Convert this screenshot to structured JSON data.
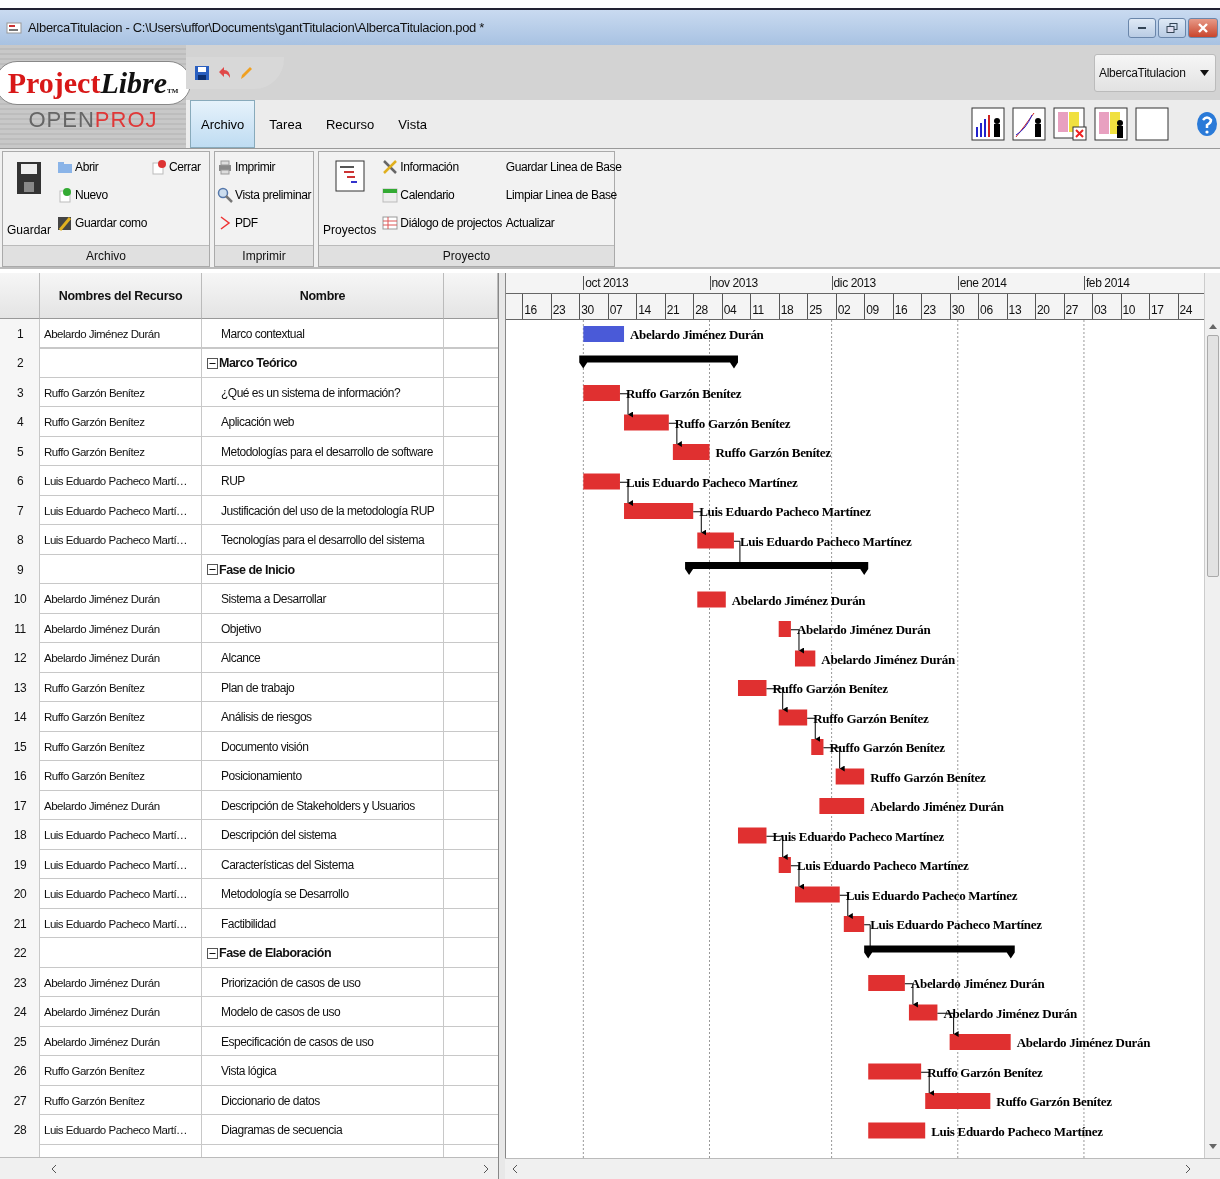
{
  "window": {
    "title": "AlbercaTitulacion - C:\\Users\\uffor\\Documents\\gantTitulacion\\AlbercaTitulacion.pod *"
  },
  "logo": {
    "first": "Project",
    "second": "Libre",
    "mark": "TM",
    "sub_first": "OPEN",
    "sub_second": "PROJ"
  },
  "project_selector": {
    "value": "AlbercaTitulacion"
  },
  "tabs": [
    {
      "label": "Archivo",
      "selected": true
    },
    {
      "label": "Tarea",
      "selected": false
    },
    {
      "label": "Recurso",
      "selected": false
    },
    {
      "label": "Vista",
      "selected": false
    }
  ],
  "ribbon": {
    "archivo": {
      "title": "Archivo",
      "save": "Guardar",
      "open": "Abrir",
      "new": "Nuevo",
      "save_as": "Guardar como",
      "close": "Cerrar"
    },
    "imprimir": {
      "title": "Imprimir",
      "print": "Imprimir",
      "preview": "Vista preliminar",
      "pdf": "PDF"
    },
    "proyecto": {
      "title": "Proyecto",
      "projects": "Proyectos",
      "info": "Información",
      "calendar": "Calendario",
      "dialog": "Diálogo de projectos",
      "save_baseline": "Guardar Linea de Base",
      "clear_baseline": "Limpiar Linea de Base",
      "update": "Actualizar"
    }
  },
  "table": {
    "columns": [
      "Nombres del Recurso",
      "Nombre"
    ]
  },
  "timescale": {
    "months": [
      "oct 2013",
      "nov 2013",
      "dic 2013",
      "ene 2014",
      "feb 2014"
    ],
    "weeks": [
      "16",
      "23",
      "30",
      "07",
      "14",
      "21",
      "28",
      "04",
      "11",
      "18",
      "25",
      "02",
      "09",
      "16",
      "23",
      "30",
      "06",
      "13",
      "20",
      "27",
      "03",
      "10",
      "17",
      "24"
    ]
  },
  "rows": [
    {
      "id": "1",
      "kind": "task",
      "resource": "Abelardo Jiménez Durán",
      "name": "Marco contextual",
      "color": "#4a5ad8",
      "bar_label": "Abelardo Jiménez Durán"
    },
    {
      "id": "2",
      "kind": "summary",
      "name": "Marco Teórico",
      "expanded": true
    },
    {
      "id": "3",
      "kind": "task",
      "resource": "Ruffo Garzón Benítez",
      "name": "¿Qué es un sistema de información?",
      "color": "#e03030",
      "bar_label": "Ruffo Garzón Benítez"
    },
    {
      "id": "4",
      "kind": "task",
      "resource": "Ruffo Garzón Benítez",
      "name": "Aplicación web",
      "color": "#e03030",
      "bar_label": "Ruffo Garzón Benítez"
    },
    {
      "id": "5",
      "kind": "task",
      "resource": "Ruffo Garzón Benítez",
      "name": "Metodologías para el desarrollo de software",
      "color": "#e03030",
      "bar_label": "Ruffo Garzón Benítez"
    },
    {
      "id": "6",
      "kind": "task",
      "resource": "Luis Eduardo Pacheco Martí…",
      "name": "RUP",
      "color": "#e03030",
      "bar_label": "Luis Eduardo Pacheco Martínez"
    },
    {
      "id": "7",
      "kind": "task",
      "resource": "Luis Eduardo Pacheco Martí…",
      "name": "Justificación  del uso de la metodología RUP",
      "color": "#e03030",
      "bar_label": "Luis Eduardo Pacheco Martínez"
    },
    {
      "id": "8",
      "kind": "task",
      "resource": "Luis Eduardo Pacheco Martí…",
      "name": "Tecnologías para el desarrollo del sistema",
      "color": "#e03030",
      "bar_label": "Luis Eduardo Pacheco Martínez"
    },
    {
      "id": "9",
      "kind": "summary",
      "name": "Fase de Inicio",
      "expanded": true
    },
    {
      "id": "10",
      "kind": "task",
      "resource": "Abelardo Jiménez Durán",
      "name": "Sistema a Desarrollar",
      "color": "#e03030",
      "bar_label": "Abelardo Jiménez Durán"
    },
    {
      "id": "11",
      "kind": "task",
      "resource": "Abelardo Jiménez Durán",
      "name": "Objetivo",
      "color": "#e03030",
      "bar_label": "Abelardo Jiménez Durán"
    },
    {
      "id": "12",
      "kind": "task",
      "resource": "Abelardo Jiménez Durán",
      "name": "Alcance",
      "color": "#e03030",
      "bar_label": "Abelardo Jiménez Durán"
    },
    {
      "id": "13",
      "kind": "task",
      "resource": "Ruffo Garzón Benítez",
      "name": "Plan de trabajo",
      "color": "#e03030",
      "bar_label": "Ruffo Garzón Benítez"
    },
    {
      "id": "14",
      "kind": "task",
      "resource": "Ruffo Garzón Benítez",
      "name": "Análisis de riesgos",
      "color": "#e03030",
      "bar_label": "Ruffo Garzón Benítez"
    },
    {
      "id": "15",
      "kind": "task",
      "resource": "Ruffo Garzón Benítez",
      "name": "Documento visión",
      "color": "#e03030",
      "bar_label": "Ruffo Garzón Benítez"
    },
    {
      "id": "16",
      "kind": "task",
      "resource": "Ruffo Garzón Benítez",
      "name": "Posicionamiento",
      "color": "#e03030",
      "bar_label": "Ruffo Garzón Benítez"
    },
    {
      "id": "17",
      "kind": "task",
      "resource": "Abelardo Jiménez Durán",
      "name": "Descripción de Stakeholders y Usuarios",
      "color": "#e03030",
      "bar_label": "Abelardo Jiménez Durán"
    },
    {
      "id": "18",
      "kind": "task",
      "resource": "Luis Eduardo Pacheco Martí…",
      "name": "Descripción del sistema",
      "color": "#e03030",
      "bar_label": "Luis Eduardo Pacheco Martínez"
    },
    {
      "id": "19",
      "kind": "task",
      "resource": "Luis Eduardo Pacheco Martí…",
      "name": "Características del Sistema",
      "color": "#e03030",
      "bar_label": "Luis Eduardo Pacheco Martínez"
    },
    {
      "id": "20",
      "kind": "task",
      "resource": "Luis Eduardo Pacheco Martí…",
      "name": "Metodología se Desarrollo",
      "color": "#e03030",
      "bar_label": "Luis Eduardo Pacheco Martínez"
    },
    {
      "id": "21",
      "kind": "task",
      "resource": "Luis Eduardo Pacheco Martí…",
      "name": "Factibilidad",
      "color": "#e03030",
      "bar_label": "Luis Eduardo Pacheco Martínez"
    },
    {
      "id": "22",
      "kind": "summary",
      "name": "Fase de Elaboración",
      "expanded": true
    },
    {
      "id": "23",
      "kind": "task",
      "resource": "Abelardo Jiménez Durán",
      "name": "Priorización de casos de uso",
      "color": "#e03030",
      "bar_label": "Abelardo Jiménez Durán"
    },
    {
      "id": "24",
      "kind": "task",
      "resource": "Abelardo Jiménez Durán",
      "name": "Modelo de casos de uso",
      "color": "#e03030",
      "bar_label": "Abelardo Jiménez Durán"
    },
    {
      "id": "25",
      "kind": "task",
      "resource": "Abelardo Jiménez Durán",
      "name": "Especificación de casos de uso",
      "color": "#e03030",
      "bar_label": "Abelardo Jiménez Durán"
    },
    {
      "id": "26",
      "kind": "task",
      "resource": "Ruffo Garzón Benítez",
      "name": "Vista lógica",
      "color": "#e03030",
      "bar_label": "Ruffo Garzón Benítez"
    },
    {
      "id": "27",
      "kind": "task",
      "resource": "Ruffo Garzón Benítez",
      "name": "Diccionario de datos",
      "color": "#e03030",
      "bar_label": "Ruffo Garzón Benítez"
    },
    {
      "id": "28",
      "kind": "task",
      "resource": "Luis Eduardo Pacheco Martí…",
      "name": "Diagramas de secuencia",
      "color": "#e03030",
      "bar_label": "Luis Eduardo Pacheco Martínez"
    }
  ]
}
